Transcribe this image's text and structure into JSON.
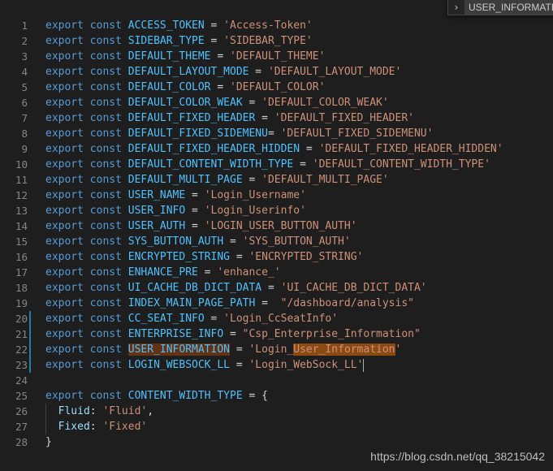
{
  "find_widget": {
    "toggle_glyph": "›",
    "query": "USER_INFORMATION"
  },
  "lines": [
    {
      "n": "1",
      "name": "ACCESS_TOKEN",
      "eq": " = ",
      "value": "'Access-Token'"
    },
    {
      "n": "2",
      "name": "SIDEBAR_TYPE",
      "eq": " = ",
      "value": "'SIDEBAR_TYPE'"
    },
    {
      "n": "3",
      "name": "DEFAULT_THEME",
      "eq": " = ",
      "value": "'DEFAULT_THEME'"
    },
    {
      "n": "4",
      "name": "DEFAULT_LAYOUT_MODE",
      "eq": " = ",
      "value": "'DEFAULT_LAYOUT_MODE'"
    },
    {
      "n": "5",
      "name": "DEFAULT_COLOR",
      "eq": " = ",
      "value": "'DEFAULT_COLOR'"
    },
    {
      "n": "6",
      "name": "DEFAULT_COLOR_WEAK",
      "eq": " = ",
      "value": "'DEFAULT_COLOR_WEAK'"
    },
    {
      "n": "7",
      "name": "DEFAULT_FIXED_HEADER",
      "eq": " = ",
      "value": "'DEFAULT_FIXED_HEADER'"
    },
    {
      "n": "8",
      "name": "DEFAULT_FIXED_SIDEMENU",
      "eq": "= ",
      "value": "'DEFAULT_FIXED_SIDEMENU'"
    },
    {
      "n": "9",
      "name": "DEFAULT_FIXED_HEADER_HIDDEN",
      "eq": " = ",
      "value": "'DEFAULT_FIXED_HEADER_HIDDEN'"
    },
    {
      "n": "10",
      "name": "DEFAULT_CONTENT_WIDTH_TYPE",
      "eq": " = ",
      "value": "'DEFAULT_CONTENT_WIDTH_TYPE'"
    },
    {
      "n": "11",
      "name": "DEFAULT_MULTI_PAGE",
      "eq": " = ",
      "value": "'DEFAULT_MULTI_PAGE'"
    },
    {
      "n": "12",
      "name": "USER_NAME",
      "eq": " = ",
      "value": "'Login_Username'"
    },
    {
      "n": "13",
      "name": "USER_INFO",
      "eq": " = ",
      "value": "'Login_Userinfo'"
    },
    {
      "n": "14",
      "name": "USER_AUTH",
      "eq": " = ",
      "value": "'LOGIN_USER_BUTTON_AUTH'"
    },
    {
      "n": "15",
      "name": "SYS_BUTTON_AUTH",
      "eq": " = ",
      "value": "'SYS_BUTTON_AUTH'"
    },
    {
      "n": "16",
      "name": "ENCRYPTED_STRING",
      "eq": " = ",
      "value": "'ENCRYPTED_STRING'"
    },
    {
      "n": "17",
      "name": "ENHANCE_PRE",
      "eq": " = ",
      "value": "'enhance_'"
    },
    {
      "n": "18",
      "name": "UI_CACHE_DB_DICT_DATA",
      "eq": " = ",
      "value": "'UI_CACHE_DB_DICT_DATA'"
    },
    {
      "n": "19",
      "name": "INDEX_MAIN_PAGE_PATH",
      "eq": " =  ",
      "value": "\"/dashboard/analysis\""
    },
    {
      "n": "20",
      "name": "CC_SEAT_INFO",
      "eq": " = ",
      "value": "'Login_CcSeatInfo'",
      "modified": true
    },
    {
      "n": "21",
      "name": "ENTERPRISE_INFO",
      "eq": " = ",
      "value": "\"Csp_Enterprise_Information\"",
      "modified": true
    },
    {
      "n": "22",
      "name": "USER_INFORMATION",
      "eq": " = ",
      "value_pre": "'Login_",
      "value_hl": "User_Information",
      "value_post": "'",
      "modified": true,
      "match": true
    },
    {
      "n": "23",
      "name": "LOGIN_WEBSOCK_LL",
      "eq": " = ",
      "value": "'Login_WebSock_LL'",
      "modified": true,
      "cursor": true
    }
  ],
  "blank_line": "24",
  "block": {
    "n_open": "25",
    "name": "CONTENT_WIDTH_TYPE",
    "eq": " = ",
    "brace_open": "{",
    "props": [
      {
        "n": "26",
        "key": "Fluid",
        "value": "'Fluid'",
        "trail": ","
      },
      {
        "n": "27",
        "key": "Fixed",
        "value": "'Fixed'",
        "trail": ""
      }
    ],
    "n_close": "28",
    "brace_close": "}"
  },
  "keywords": {
    "export": "export",
    "const": "const"
  },
  "watermark": "https://blog.csdn.net/qq_38215042",
  "colors": {
    "background": "#1e1e1e",
    "keyword": "#569cd6",
    "constant": "#4fc1ff",
    "string": "#ce9178",
    "property": "#9cdcfe",
    "gutter": "#858585",
    "modified_bar": "#1b81a8",
    "find_highlight": "#613214"
  }
}
